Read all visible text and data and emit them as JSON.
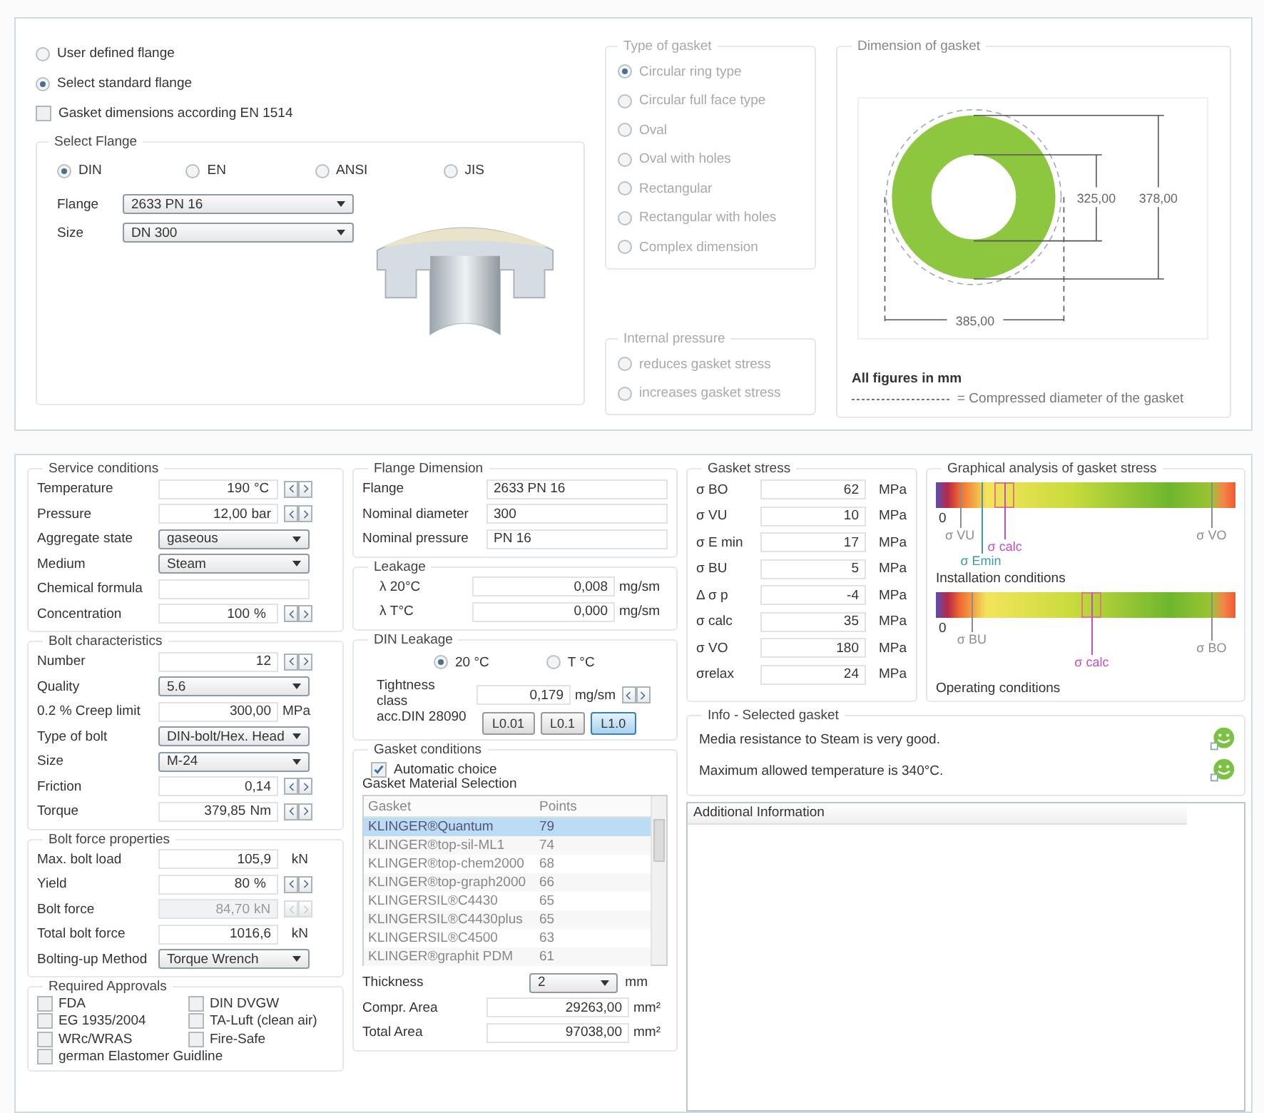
{
  "flange_source": [
    {
      "label": "User defined flange",
      "selected": false
    },
    {
      "label": "Select standard flange",
      "selected": true
    }
  ],
  "en1514": {
    "label": "Gasket dimensions according EN 1514",
    "checked": false
  },
  "select_flange": {
    "title": "Select Flange",
    "standards": [
      {
        "label": "DIN",
        "selected": true
      },
      {
        "label": "EN",
        "selected": false
      },
      {
        "label": "ANSI",
        "selected": false
      },
      {
        "label": "JIS",
        "selected": false
      }
    ],
    "fields": [
      {
        "label": "Flange",
        "value": "2633 PN 16"
      },
      {
        "label": "Size",
        "value": "DN 300"
      }
    ]
  },
  "gasket_type": {
    "title": "Type of gasket",
    "disabled": true,
    "options": [
      {
        "label": "Circular ring type",
        "selected": true
      },
      {
        "label": "Circular full face type",
        "selected": false
      },
      {
        "label": "Oval",
        "selected": false
      },
      {
        "label": "Oval with holes",
        "selected": false
      },
      {
        "label": "Rectangular",
        "selected": false
      },
      {
        "label": "Rectangular with holes",
        "selected": false
      },
      {
        "label": "Complex dimension",
        "selected": false
      }
    ]
  },
  "internal_pressure": {
    "title": "Internal pressure",
    "disabled": true,
    "options": [
      {
        "label": "reduces gasket stress",
        "selected": false
      },
      {
        "label": "increases gasket stress",
        "selected": false
      }
    ]
  },
  "dimension": {
    "title": "Dimension of gasket",
    "inner": "325,00",
    "outer": "378,00",
    "compressed": "385,00",
    "note": "All figures in mm",
    "legend": "= Compressed diameter of the gasket"
  },
  "conditions": [
    {
      "title": "Service conditions",
      "rows": [
        {
          "kind": "spin",
          "label": "Temperature",
          "value": "190",
          "unit": "°C",
          "disabled": false
        },
        {
          "kind": "spin",
          "label": "Pressure",
          "value": "12,00",
          "unit": "bar",
          "disabled": false
        },
        {
          "kind": "select",
          "label": "Aggregate state",
          "value": "gaseous",
          "disabled": false
        },
        {
          "kind": "select",
          "label": "Medium",
          "value": "Steam",
          "disabled": false
        },
        {
          "kind": "text",
          "label": "Chemical formula",
          "disabled": false
        },
        {
          "kind": "spin",
          "label": "Concentration",
          "value": "100",
          "unit": "%",
          "disabled": false
        }
      ]
    },
    {
      "title": "Bolt characteristics",
      "rows": [
        {
          "kind": "spin",
          "label": "Number",
          "value": "12",
          "disabled": false
        },
        {
          "kind": "select",
          "label": "Quality",
          "value": "5.6",
          "disabled": false
        },
        {
          "kind": "unit",
          "label": "0.2 % Creep limit",
          "value": "300,00",
          "unit": "MPa",
          "disabled": false
        },
        {
          "kind": "select",
          "label": "Type of bolt",
          "value": "DIN-bolt/Hex. Head",
          "disabled": false
        },
        {
          "kind": "select",
          "label": "Size",
          "value": "M-24",
          "disabled": false
        },
        {
          "kind": "spin",
          "label": "Friction",
          "value": "0,14",
          "disabled": false
        },
        {
          "kind": "spin",
          "label": "Torque",
          "value": "379,85",
          "unit": "Nm",
          "disabled": false
        }
      ]
    },
    {
      "title": "Bolt force properties",
      "rows": [
        {
          "kind": "unit",
          "label": "Max. bolt load",
          "value": "105,9",
          "unit": "kN",
          "disabled": false
        },
        {
          "kind": "spin",
          "label": "Yield",
          "value": "80",
          "unit": "%",
          "disabled": false
        },
        {
          "kind": "spin",
          "label": "Bolt force",
          "value": "84,70",
          "unit": "kN",
          "disabled": true
        },
        {
          "kind": "unit",
          "label": "Total bolt force",
          "value": "1016,6",
          "unit": "kN",
          "disabled": false
        },
        {
          "kind": "select",
          "label": "Bolting-up Method",
          "value": "Torque Wrench",
          "disabled": false
        }
      ]
    }
  ],
  "approvals": {
    "title": "Required Approvals",
    "items": [
      {
        "label": "FDA",
        "checked": false
      },
      {
        "label": "DIN DVGW",
        "checked": false
      },
      {
        "label": "EG 1935/2004",
        "checked": false
      },
      {
        "label": "TA-Luft (clean air)",
        "checked": false
      },
      {
        "label": "WRc/WRAS",
        "checked": false
      },
      {
        "label": "Fire-Safe",
        "checked": false
      },
      {
        "label": "german Elastomer Guidline",
        "checked": false
      }
    ]
  },
  "flange_dimension": {
    "title": "Flange Dimension",
    "rows": [
      {
        "label": "Flange",
        "value": "2633 PN 16"
      },
      {
        "label": "Nominal diameter",
        "value": "300"
      },
      {
        "label": "Nominal pressure",
        "value": "PN 16"
      }
    ]
  },
  "leakage": {
    "title": "Leakage",
    "rows": [
      {
        "label": "λ 20°C",
        "value": "0,008",
        "unit": "mg/sm"
      },
      {
        "label": "λ T°C",
        "value": "0,000",
        "unit": "mg/sm"
      }
    ]
  },
  "din_leakage": {
    "title": "DIN Leakage",
    "temps": [
      {
        "label": "20 °C",
        "selected": true
      },
      {
        "label": "T °C",
        "selected": false
      }
    ],
    "class_label": [
      "Tightness class",
      "acc.DIN 28090"
    ],
    "value": "0,179",
    "unit": "mg/sm",
    "classes": [
      {
        "label": "L0.01",
        "selected": false
      },
      {
        "label": "L0.1",
        "selected": false
      },
      {
        "label": "L1.0",
        "selected": true
      }
    ]
  },
  "gasket_conditions": {
    "title": "Gasket conditions",
    "auto": {
      "label": "Automatic choice",
      "checked": true
    },
    "selection_title": "Gasket Material Selection",
    "columns": [
      "Gasket",
      "Points"
    ],
    "rows": [
      {
        "name": "KLINGER®Quantum",
        "points": "79",
        "selected": true
      },
      {
        "name": "KLINGER®top-sil-ML1",
        "points": "74",
        "selected": false
      },
      {
        "name": "KLINGER®top-chem2000",
        "points": "68",
        "selected": false
      },
      {
        "name": "KLINGER®top-graph2000",
        "points": "66",
        "selected": false
      },
      {
        "name": "KLINGERSIL®C4430",
        "points": "65",
        "selected": false
      },
      {
        "name": "KLINGERSIL®C4430plus",
        "points": "65",
        "selected": false
      },
      {
        "name": "KLINGERSIL®C4500",
        "points": "63",
        "selected": false
      },
      {
        "name": "KLINGER®graphit PDM",
        "points": "61",
        "selected": false
      }
    ],
    "thickness": {
      "label": "Thickness",
      "value": "2",
      "unit": "mm"
    },
    "areas": [
      {
        "label": "Compr. Area",
        "value": "29263,00",
        "unit": "mm²"
      },
      {
        "label": "Total Area",
        "value": "97038,00",
        "unit": "mm²"
      }
    ]
  },
  "gasket_stress": {
    "title": "Gasket stress",
    "rows": [
      {
        "label": "σ BO",
        "value": "62",
        "unit": "MPa"
      },
      {
        "label": "σ VU",
        "value": "10",
        "unit": "MPa"
      },
      {
        "label": "σ E min",
        "value": "17",
        "unit": "MPa"
      },
      {
        "label": "σ BU",
        "value": "5",
        "unit": "MPa"
      },
      {
        "label": "Δ σ p",
        "value": "-4",
        "unit": "MPa"
      },
      {
        "label": "σ calc",
        "value": "35",
        "unit": "MPa"
      },
      {
        "label": "σ VO",
        "value": "180",
        "unit": "MPa"
      },
      {
        "label": "σrelax",
        "value": "24",
        "unit": "MPa"
      }
    ]
  },
  "graph": {
    "title": "Graphical analysis of gasket stress",
    "gauges": [
      {
        "zero": "0",
        "caption": "Installation conditions",
        "markers": [
          {
            "kind": "limit",
            "label": "σ VU",
            "color": "#8c8c8c"
          },
          {
            "kind": "limit",
            "label": "σ Emin",
            "color": "#3a9c9c"
          },
          {
            "kind": "calc",
            "label": "σ calc",
            "color": "#c24fc2"
          },
          {
            "kind": "limit",
            "label": "σ VO",
            "color": "#8c8c8c"
          }
        ]
      },
      {
        "zero": "0",
        "caption": "Operating conditions",
        "markers": [
          {
            "kind": "limit",
            "label": "σ BU",
            "color": "#8c8c8c"
          },
          {
            "kind": "calc",
            "label": "σ calc",
            "color": "#c24fc2"
          },
          {
            "kind": "limit",
            "label": "σ BO",
            "color": "#8c8c8c"
          }
        ]
      }
    ]
  },
  "info": {
    "title": "Info - Selected gasket",
    "messages": [
      "Media resistance to Steam is very good.",
      "Maximum allowed temperature is 340°C."
    ]
  },
  "additional": {
    "title": "Additional Information"
  }
}
